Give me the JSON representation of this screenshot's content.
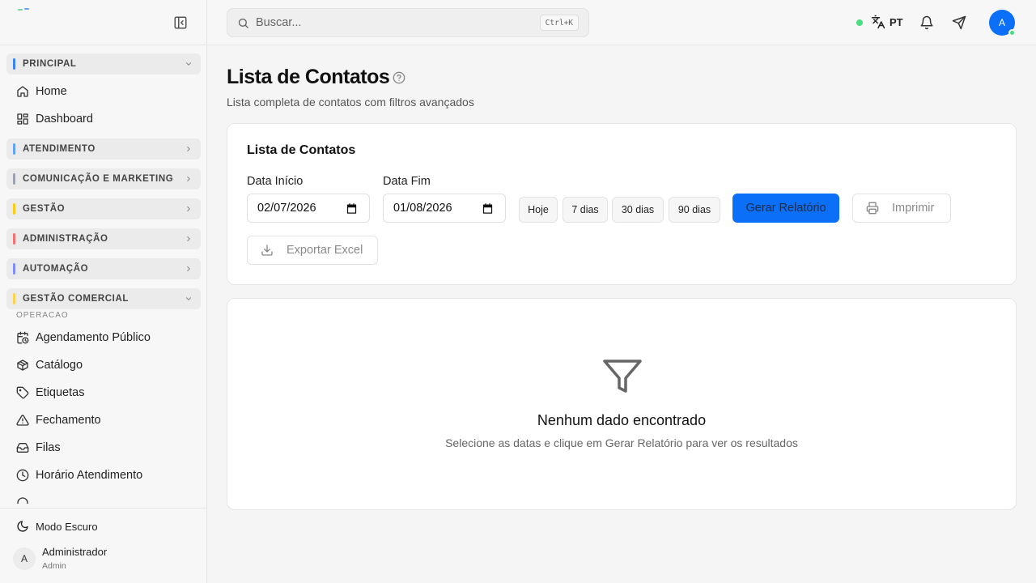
{
  "sidebar": {
    "groups": {
      "principal": "PRINCIPAL",
      "atendimento": "ATENDIMENTO",
      "comunicacao": "COMUNICAÇÃO E MARKETING",
      "gestao": "GESTÃO",
      "administracao": "ADMINISTRAÇÃO",
      "automacao": "AUTOMAÇÃO",
      "gestao_comercial": "GESTÃO COMERCIAL"
    },
    "items": {
      "home": "Home",
      "dashboard": "Dashboard",
      "agendamento": "Agendamento Público",
      "catalogo": "Catálogo",
      "etiquetas": "Etiquetas",
      "fechamento": "Fechamento",
      "filas": "Filas",
      "horario": "Horário Atendimento"
    },
    "section_label": "OPERACAO",
    "dark_mode": "Modo Escuro",
    "user": {
      "initial": "A",
      "name": "Administrador",
      "role": "Admin"
    }
  },
  "header": {
    "search_placeholder": "Buscar...",
    "shortcut": "Ctrl+K",
    "language": "PT",
    "avatar_initial": "A"
  },
  "page": {
    "title": "Lista de Contatos",
    "subtitle": "Lista completa de contatos com filtros avançados"
  },
  "filters": {
    "card_title": "Lista de Contatos",
    "start_label": "Data Início",
    "start_value": "02/07/2026",
    "end_label": "Data Fim",
    "end_value": "01/08/2026",
    "quick": {
      "today": "Hoje",
      "d7": "7 dias",
      "d30": "30 dias",
      "d90": "90 dias"
    },
    "generate": "Gerar Relatório",
    "print": "Imprimir",
    "export": "Exportar Excel"
  },
  "empty": {
    "title": "Nenhum dado encontrado",
    "subtitle": "Selecione as datas e clique em Gerar Relatório para ver os resultados"
  },
  "colors": {
    "primary": "#0b6ff7",
    "online": "#4ade80",
    "bar_principal": "#3b82f6",
    "bar_atendimento": "#60a5fa",
    "bar_comunicacao": "#9ca3af",
    "bar_gestao": "#facc15",
    "bar_administracao": "#f87171",
    "bar_automacao": "#818cf8",
    "bar_gestao_comercial": "#fcd34d"
  }
}
